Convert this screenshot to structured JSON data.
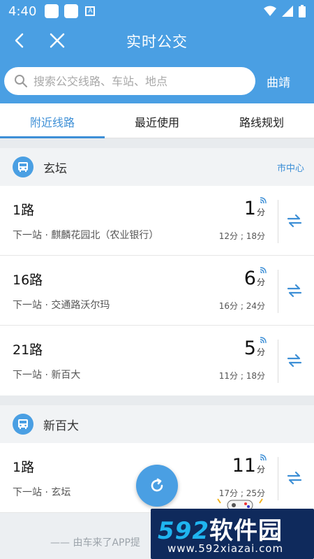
{
  "status_bar": {
    "time": "4:40",
    "a_badge": "A"
  },
  "header": {
    "title": "实时公交"
  },
  "search": {
    "placeholder": "搜索公交线路、车站、地点",
    "city": "曲靖"
  },
  "tabs": [
    {
      "label": "附近线路",
      "active": true
    },
    {
      "label": "最近使用",
      "active": false
    },
    {
      "label": "路线规划",
      "active": false
    }
  ],
  "stations": [
    {
      "name": "玄坛",
      "tag": "市中心",
      "routes": [
        {
          "name": "1路",
          "next_stop": "下一站 · 麒麟花园北（农业银行）",
          "minutes": "1",
          "unit": "分",
          "later": "12分 ; 18分"
        },
        {
          "name": "16路",
          "next_stop": "下一站 · 交通路沃尔玛",
          "minutes": "6",
          "unit": "分",
          "later": "16分 ; 24分"
        },
        {
          "name": "21路",
          "next_stop": "下一站 · 新百大",
          "minutes": "5",
          "unit": "分",
          "later": "11分 ; 18分"
        }
      ]
    },
    {
      "name": "新百大",
      "tag": "",
      "routes": [
        {
          "name": "1路",
          "next_stop": "下一站 · 玄坛",
          "minutes": "11",
          "unit": "分",
          "later": "17分 ; 25分"
        }
      ]
    }
  ],
  "footer_tip": "—— 由车来了APP提",
  "watermark": {
    "brand_num": "592",
    "brand_text": "软件园",
    "url": "www.592xiazai.com"
  },
  "colors": {
    "primary": "#4a9fe3",
    "accent": "#3d8fd6",
    "watermark_bg": "#0f2a5c"
  }
}
